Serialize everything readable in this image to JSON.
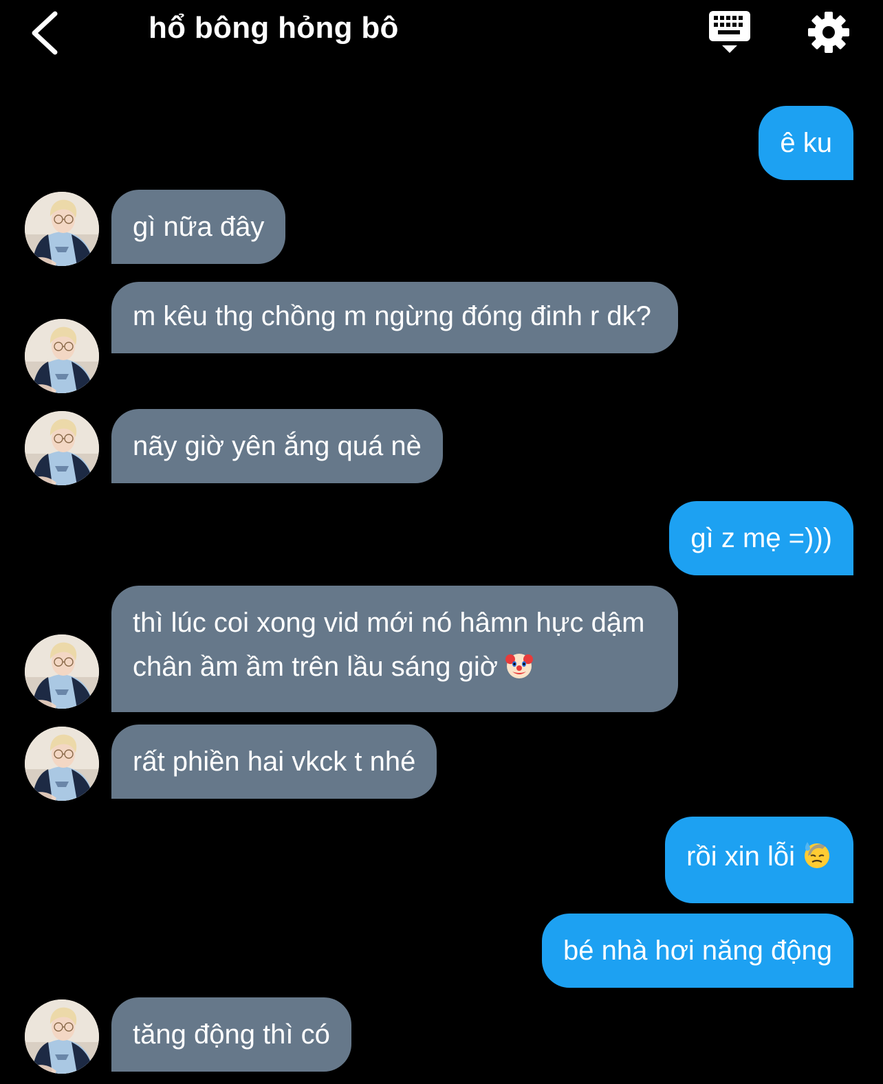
{
  "header": {
    "title": "hổ bông hỏng bô",
    "back_icon": "chevron-left-icon",
    "keyboard_icon": "keyboard-icon",
    "settings_icon": "gear-icon"
  },
  "colors": {
    "incoming_bubble": "#66788a",
    "outgoing_bubble": "#1da1f2",
    "background": "#000000"
  },
  "messages": [
    {
      "side": "out",
      "text": "ê ku"
    },
    {
      "side": "in",
      "text": "gì nữa đây"
    },
    {
      "side": "in",
      "text": "m kêu thg chồng m ngừng đóng đinh r dk?"
    },
    {
      "side": "in",
      "text": "nãy giờ yên ắng quá nè"
    },
    {
      "side": "out",
      "text": "gì z mẹ =)))"
    },
    {
      "side": "in",
      "text": "thì lúc coi xong vid mới nó hâmn hực dậm chân ầm ầm trên lầu sáng giờ",
      "emoji": "clown-face-icon"
    },
    {
      "side": "in",
      "text": "rất phiền hai vkck t nhé"
    },
    {
      "side": "out",
      "text": "rồi xin lỗi",
      "emoji": "sad-sweat-face-icon"
    },
    {
      "side": "out",
      "text": "bé nhà hơi năng động"
    },
    {
      "side": "in",
      "text": "tăng động thì có"
    }
  ]
}
